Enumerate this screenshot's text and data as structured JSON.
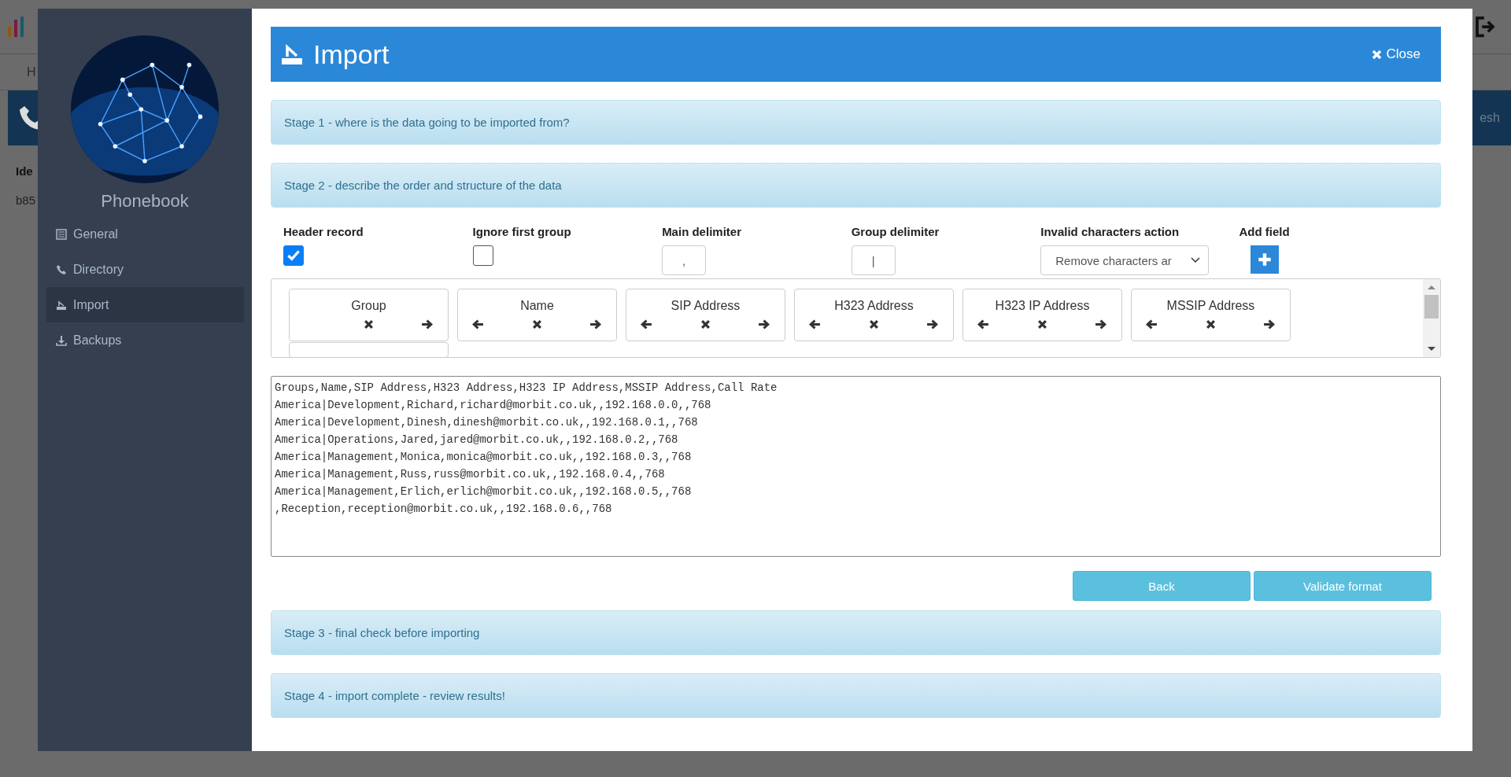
{
  "background": {
    "nav_fragment": "H",
    "column_fragment": "Ide",
    "cell_fragment": "b85",
    "button_fragment": "esh"
  },
  "sidebar": {
    "title": "Phonebook",
    "items": [
      {
        "label": "General",
        "selected": false
      },
      {
        "label": "Directory",
        "selected": false
      },
      {
        "label": "Import",
        "selected": true
      },
      {
        "label": "Backups",
        "selected": false
      }
    ]
  },
  "header": {
    "title": "Import",
    "close_label": "Close"
  },
  "stages": [
    {
      "title": "Stage 1 - where is the data going to be imported from?"
    },
    {
      "title": "Stage 2 - describe the order and structure of the data"
    },
    {
      "title": "Stage 3 - final check before importing"
    },
    {
      "title": "Stage 4 - import complete - review results!"
    }
  ],
  "options": [
    {
      "kind": "checkbox",
      "label": "Header record",
      "checked": true
    },
    {
      "kind": "checkbox",
      "label": "Ignore first group",
      "checked": false
    },
    {
      "kind": "text",
      "label": "Main delimiter",
      "value": ","
    },
    {
      "kind": "text",
      "label": "Group delimiter",
      "value": "|"
    },
    {
      "kind": "select",
      "label": "Invalid characters action",
      "value": "Remove characters ar"
    },
    {
      "kind": "add",
      "label": "Add field"
    }
  ],
  "fields": [
    {
      "name": "Group",
      "can_move_left": false,
      "can_move_right": true
    },
    {
      "name": "Name",
      "can_move_left": true,
      "can_move_right": true
    },
    {
      "name": "SIP Address",
      "can_move_left": true,
      "can_move_right": true
    },
    {
      "name": "H323 Address",
      "can_move_left": true,
      "can_move_right": true
    },
    {
      "name": "H323 IP Address",
      "can_move_left": true,
      "can_move_right": true
    },
    {
      "name": "MSSIP Address",
      "can_move_left": true,
      "can_move_right": true
    }
  ],
  "data_lines": [
    "Groups,Name,SIP Address,H323 Address,H323 IP Address,MSSIP Address,Call Rate",
    "America|Development,Richard,richard@morbit.co.uk,,192.168.0.0,,768",
    "America|Development,Dinesh,dinesh@morbit.co.uk,,192.168.0.1,,768",
    "America|Operations,Jared,jared@morbit.co.uk,,192.168.0.2,,768",
    "America|Management,Monica,monica@morbit.co.uk,,192.168.0.3,,768",
    "America|Management,Russ,russ@morbit.co.uk,,192.168.0.4,,768",
    "America|Management,Erlich,erlich@morbit.co.uk,,192.168.0.5,,768",
    ",Reception,reception@morbit.co.uk,,192.168.0.6,,768"
  ],
  "buttons": [
    "Back",
    "Validate format"
  ]
}
